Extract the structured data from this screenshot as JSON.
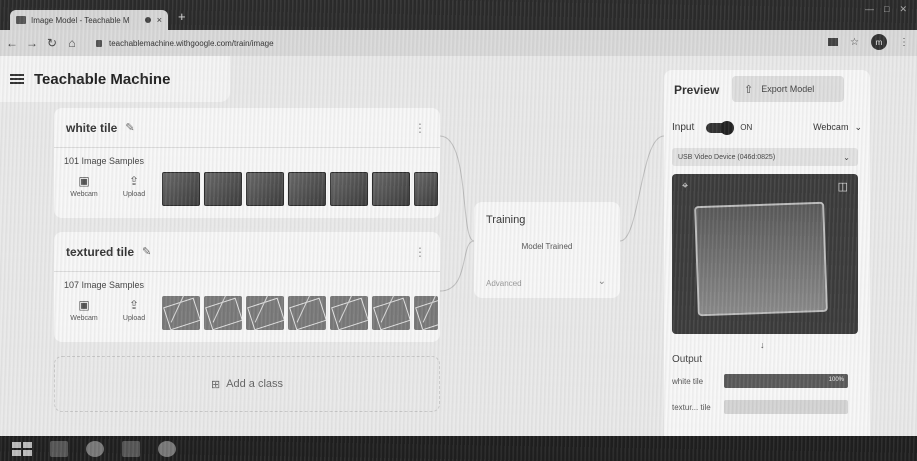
{
  "browser": {
    "tab_title": "Image Model - Teachable M",
    "tab_close": "×",
    "new_tab": "+",
    "url": "teachablemachine.withgoogle.com/train/image",
    "avatar_letter": "m"
  },
  "app": {
    "title": "Teachable Machine"
  },
  "classes": [
    {
      "name": "white tile",
      "samples_label": "101 Image Samples",
      "webcam_label": "Webcam",
      "upload_label": "Upload",
      "thumbnail_style": "plain"
    },
    {
      "name": "textured tile",
      "samples_label": "107 Image Samples",
      "webcam_label": "Webcam",
      "upload_label": "Upload",
      "thumbnail_style": "textured"
    }
  ],
  "add_class_label": "Add a class",
  "training": {
    "title": "Training",
    "status": "Model Trained",
    "advanced_label": "Advanced"
  },
  "preview": {
    "title": "Preview",
    "export_label": "Export Model",
    "input_label": "Input",
    "toggle_state": "ON",
    "source_select": "Webcam",
    "device_select": "USB Video Device (046d:0825)",
    "output_title": "Output",
    "outputs": [
      {
        "label": "white tile",
        "percent": 100,
        "percent_text": "100%"
      },
      {
        "label": "textur... tile",
        "percent": 0,
        "percent_text": ""
      }
    ]
  },
  "colors": {
    "panel": "#f7f7f7",
    "background": "#e9e9e9",
    "accent_dark": "#333333"
  }
}
